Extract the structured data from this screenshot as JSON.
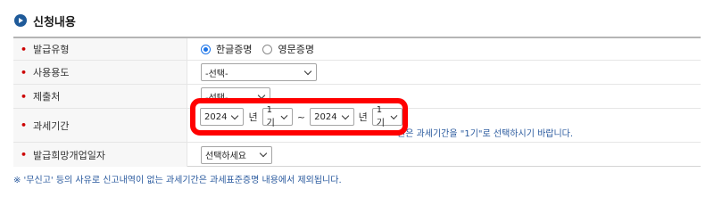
{
  "section": {
    "title": "신청내용"
  },
  "rows": {
    "issue_type": {
      "label": "발급유형",
      "options": [
        {
          "label": "한글증명",
          "checked": true
        },
        {
          "label": "영문증명",
          "checked": false
        }
      ]
    },
    "usage": {
      "label": "사용용도",
      "value": "-선택-"
    },
    "submit_to": {
      "label": "제출처",
      "value": "-선택-"
    },
    "tax_period": {
      "label": "과세기간",
      "from_year": "2024",
      "from_year_unit": "년",
      "from_term": "1기",
      "range_sep": "~",
      "to_year": "2024",
      "to_year_unit": "년",
      "to_term": "1기",
      "note": "원은 과세기간을 \"1기\"로 선택하시기 바랍니다."
    },
    "receive_date": {
      "label": "발급희망개업일자",
      "value": "선택하세요"
    }
  },
  "footer_note": "※ '무신고' 등의 사유로 신고내역이 없는 과세기간은 과세표준증명 내용에서 제외됩니다.",
  "colors": {
    "required": "#cc0000",
    "highlight": "#ff0000",
    "note": "#2a5a9e",
    "section_icon": "#1e5a99"
  }
}
